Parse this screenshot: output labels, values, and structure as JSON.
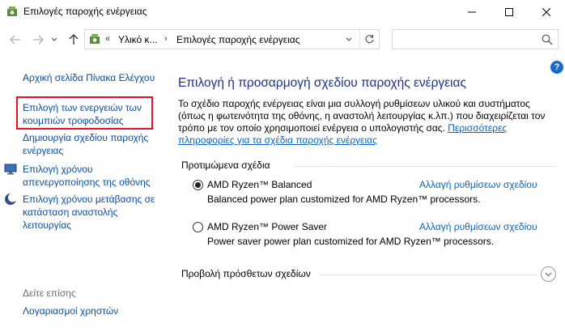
{
  "window": {
    "title": "Επιλογές παροχής ενέργειας",
    "controls": {
      "minimize": "minimize-icon",
      "maximize": "maximize-icon",
      "close": "close-icon"
    }
  },
  "address": {
    "overflow": "«",
    "segments": [
      "Υλικό κ...",
      "Επιλογές παροχής ενέργειας"
    ],
    "separator": "›"
  },
  "search": {
    "placeholder": ""
  },
  "sidebar": {
    "home": "Αρχική σελίδα Πίνακα Ελέγχου",
    "items": [
      {
        "label": "Επιλογή των ενεργειών των κουμπιών τροφοδοσίας",
        "highlighted": true
      },
      {
        "label": "Δημιουργία σχεδίου παροχής ενέργειας"
      },
      {
        "label": "Επιλογή χρόνου απενεργοποίησης της οθόνης",
        "icon": "display-icon"
      },
      {
        "label": "Επιλογή χρόνου μετάβασης σε κατάσταση αναστολής λειτουργίας",
        "icon": "moon-icon"
      }
    ],
    "see_also": "Δείτε επίσης",
    "see_also_items": [
      "Λογαριασμοί χρηστών"
    ]
  },
  "main": {
    "title": "Επιλογή ή προσαρμογή σχεδίου παροχής ενέργειας",
    "description": "Το σχέδιο παροχής ενέργειας είναι μια συλλογή ρυθμίσεων υλικού και συστήματος (όπως η φωτεινότητα της οθόνης, η αναστολή λειτουργίας κ.λπ.) που διαχειρίζεται τον τρόπο με τον οποίο χρησιμοποιεί ενέργεια ο υπολογιστής σας.",
    "description_link": "Περισσότερες πληροφορίες για τα σχέδια παροχής ενέργειας",
    "preferred_label": "Προτιμώμενα σχέδια",
    "plans": [
      {
        "name": "AMD Ryzen™ Balanced",
        "description": "Balanced power plan customized for AMD Ryzen™ processors.",
        "link": "Αλλαγή ρυθμίσεων σχεδίου",
        "selected": true
      },
      {
        "name": "AMD Ryzen™ Power Saver",
        "description": "Power saver power plan customized for AMD Ryzen™ processors.",
        "link": "Αλλαγή ρυθμίσεων σχεδίου",
        "selected": false
      }
    ],
    "more_plans": "Προβολή πρόσθετων σχεδίων"
  },
  "colors": {
    "link": "#0a4ea3",
    "title": "#1e3287",
    "highlight": "#e81123"
  }
}
